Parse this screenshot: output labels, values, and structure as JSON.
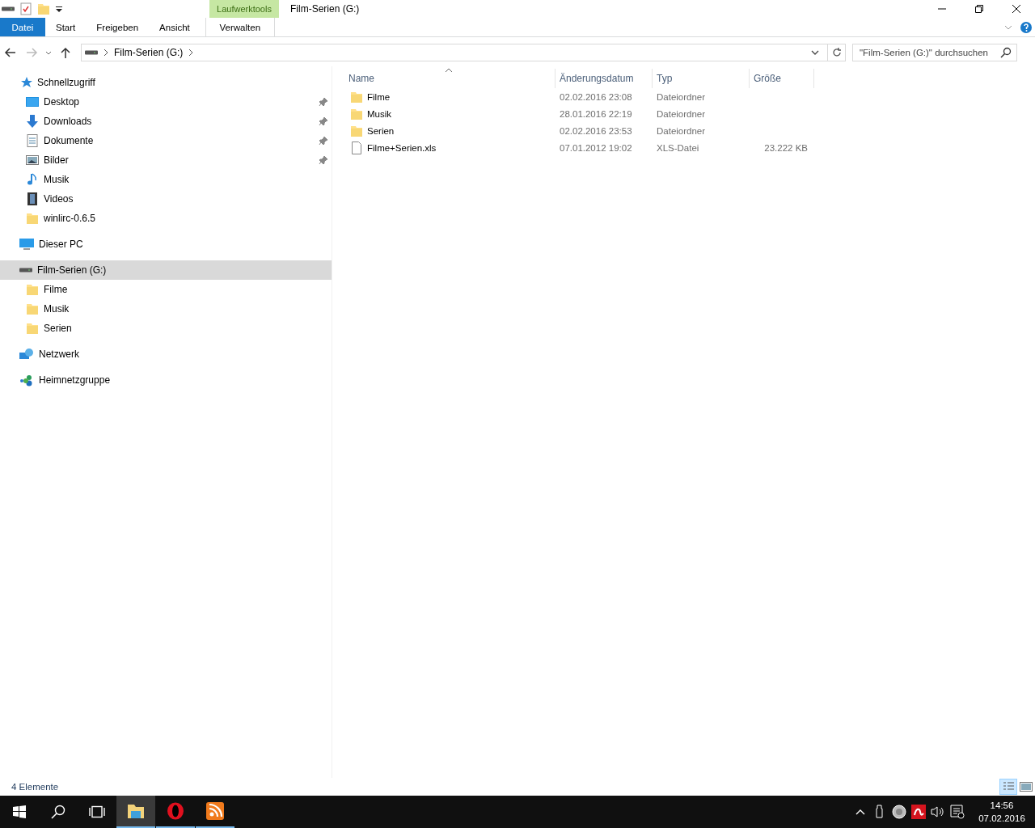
{
  "window": {
    "title": "Film-Serien (G:)",
    "context_group": "Laufwerktools"
  },
  "quick_access": [
    {
      "kind": "drive"
    },
    {
      "kind": "properties"
    },
    {
      "kind": "folder"
    },
    {
      "kind": "customize"
    }
  ],
  "ribbon_tabs": [
    {
      "label": "Datei",
      "kind": "file"
    },
    {
      "label": "Start",
      "kind": "normal"
    },
    {
      "label": "Freigeben",
      "kind": "normal"
    },
    {
      "label": "Ansicht",
      "kind": "normal"
    },
    {
      "label": "Verwalten",
      "kind": "context"
    }
  ],
  "address_bar": {
    "path": [
      "Film-Serien (G:)"
    ]
  },
  "search": {
    "placeholder": "\"Film-Serien (G:)\" durchsuchen"
  },
  "sidebar": {
    "items": [
      {
        "label": "Schnellzugriff",
        "kind": "star",
        "selected": false,
        "children": [
          {
            "label": "Desktop",
            "kind": "desktop",
            "pinned": true,
            "selected": false
          },
          {
            "label": "Downloads",
            "kind": "download",
            "pinned": true,
            "selected": false
          },
          {
            "label": "Dokumente",
            "kind": "documents",
            "pinned": true,
            "selected": false
          },
          {
            "label": "Bilder",
            "kind": "pictures",
            "pinned": true,
            "selected": false
          },
          {
            "label": "Musik",
            "kind": "music",
            "pinned": false,
            "selected": false
          },
          {
            "label": "Videos",
            "kind": "videos",
            "pinned": false,
            "selected": false
          },
          {
            "label": "winlirc-0.6.5",
            "kind": "folder",
            "pinned": false,
            "selected": false
          }
        ]
      },
      {
        "label": "Dieser PC",
        "kind": "pc",
        "selected": false
      },
      {
        "label": "Film-Serien (G:)",
        "kind": "drive",
        "selected": true,
        "children": [
          {
            "label": "Filme",
            "kind": "folder",
            "pinned": false,
            "selected": false
          },
          {
            "label": "Musik",
            "kind": "folder",
            "pinned": false,
            "selected": false
          },
          {
            "label": "Serien",
            "kind": "folder",
            "pinned": false,
            "selected": false
          }
        ]
      },
      {
        "label": "Netzwerk",
        "kind": "network",
        "selected": false
      },
      {
        "label": "Heimnetzgruppe",
        "kind": "homegroup",
        "selected": false
      }
    ]
  },
  "table": {
    "columns": [
      {
        "label": "Name",
        "sorted": true
      },
      {
        "label": "Änderungsdatum",
        "sorted": false
      },
      {
        "label": "Typ",
        "sorted": false
      },
      {
        "label": "Größe",
        "sorted": false
      }
    ],
    "rows": [
      {
        "name": "Filme",
        "kind": "folder",
        "date": "02.02.2016 23:08",
        "type": "Dateiordner",
        "selected": false
      },
      {
        "name": "Musik",
        "kind": "folder",
        "date": "28.01.2016 22:19",
        "type": "Dateiordner",
        "selected": false
      },
      {
        "name": "Serien",
        "kind": "folder",
        "date": "02.02.2016 23:53",
        "type": "Dateiordner",
        "selected": false
      },
      {
        "name": "Filme+Serien.xls",
        "kind": "file",
        "date": "07.01.2012 19:02",
        "type": "XLS-Datei",
        "size": "23.222 KB",
        "selected": false
      }
    ]
  },
  "status_bar": {
    "text": "4 Elemente",
    "views": [
      {
        "kind": "details",
        "selected": true
      },
      {
        "kind": "largeicons",
        "selected": false
      }
    ]
  },
  "taskbar": {
    "apps": [
      {
        "kind": "explorer",
        "active": true,
        "running": true
      },
      {
        "kind": "opera",
        "active": false,
        "running": true
      },
      {
        "kind": "feed",
        "active": false,
        "running": true
      }
    ],
    "tray": [
      {
        "kind": "trayup"
      },
      {
        "kind": "usb"
      },
      {
        "kind": "disc"
      },
      {
        "kind": "avira"
      },
      {
        "kind": "speaker"
      },
      {
        "kind": "notification"
      }
    ],
    "time": "14:56",
    "date": "07.02.2016"
  }
}
